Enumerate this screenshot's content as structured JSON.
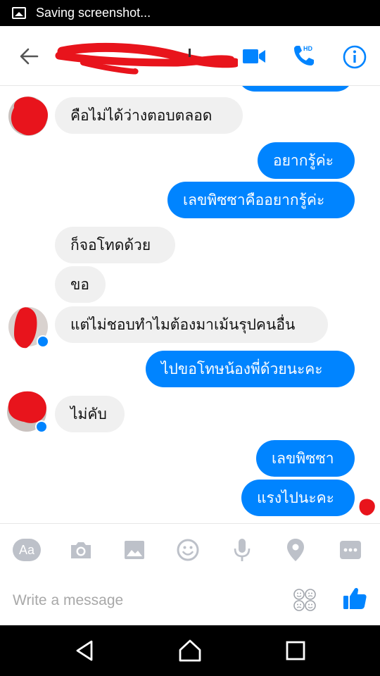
{
  "status_bar": {
    "text": "Saving screenshot..."
  },
  "header": {
    "hd_badge": "HD"
  },
  "messages": [
    {
      "id": "m1",
      "side": "in",
      "text": "คือไม่ได้ว่างตอบตลอด"
    },
    {
      "id": "m2",
      "side": "out",
      "text": "อยากรู้ค่ะ"
    },
    {
      "id": "m3",
      "side": "out",
      "text": "เลขพิซซาคืออยากรู้ค่ะ"
    },
    {
      "id": "m4",
      "side": "in",
      "text": "ก็จอโทดด้วย"
    },
    {
      "id": "m5",
      "side": "in",
      "text": "ขอ"
    },
    {
      "id": "m6",
      "side": "in",
      "text": "แต่ไม่ชอบทำไมต้องมาเม้นรุปคนอื่น"
    },
    {
      "id": "m7",
      "side": "out",
      "text": "ไปขอโทษน้องพี่ด้วยนะคะ"
    },
    {
      "id": "m8",
      "side": "in",
      "text": "ไม่คับ"
    },
    {
      "id": "m9",
      "side": "out",
      "text": "เลขพิซซา"
    },
    {
      "id": "m10",
      "side": "out",
      "text": "แรงไปนะคะ"
    }
  ],
  "toolbar": {
    "aa_label": "Aa"
  },
  "composer": {
    "placeholder": "Write a message"
  },
  "colors": {
    "accent": "#0084ff",
    "incoming_bubble": "#f0f0f0",
    "redaction": "#e8141c"
  },
  "icons": [
    "back-arrow-icon",
    "video-call-icon",
    "hd-phone-icon",
    "info-icon",
    "camera-icon",
    "gallery-icon",
    "emoji-icon",
    "microphone-icon",
    "location-pin-icon",
    "more-icon",
    "sticker-grid-icon",
    "thumbs-up-icon"
  ]
}
